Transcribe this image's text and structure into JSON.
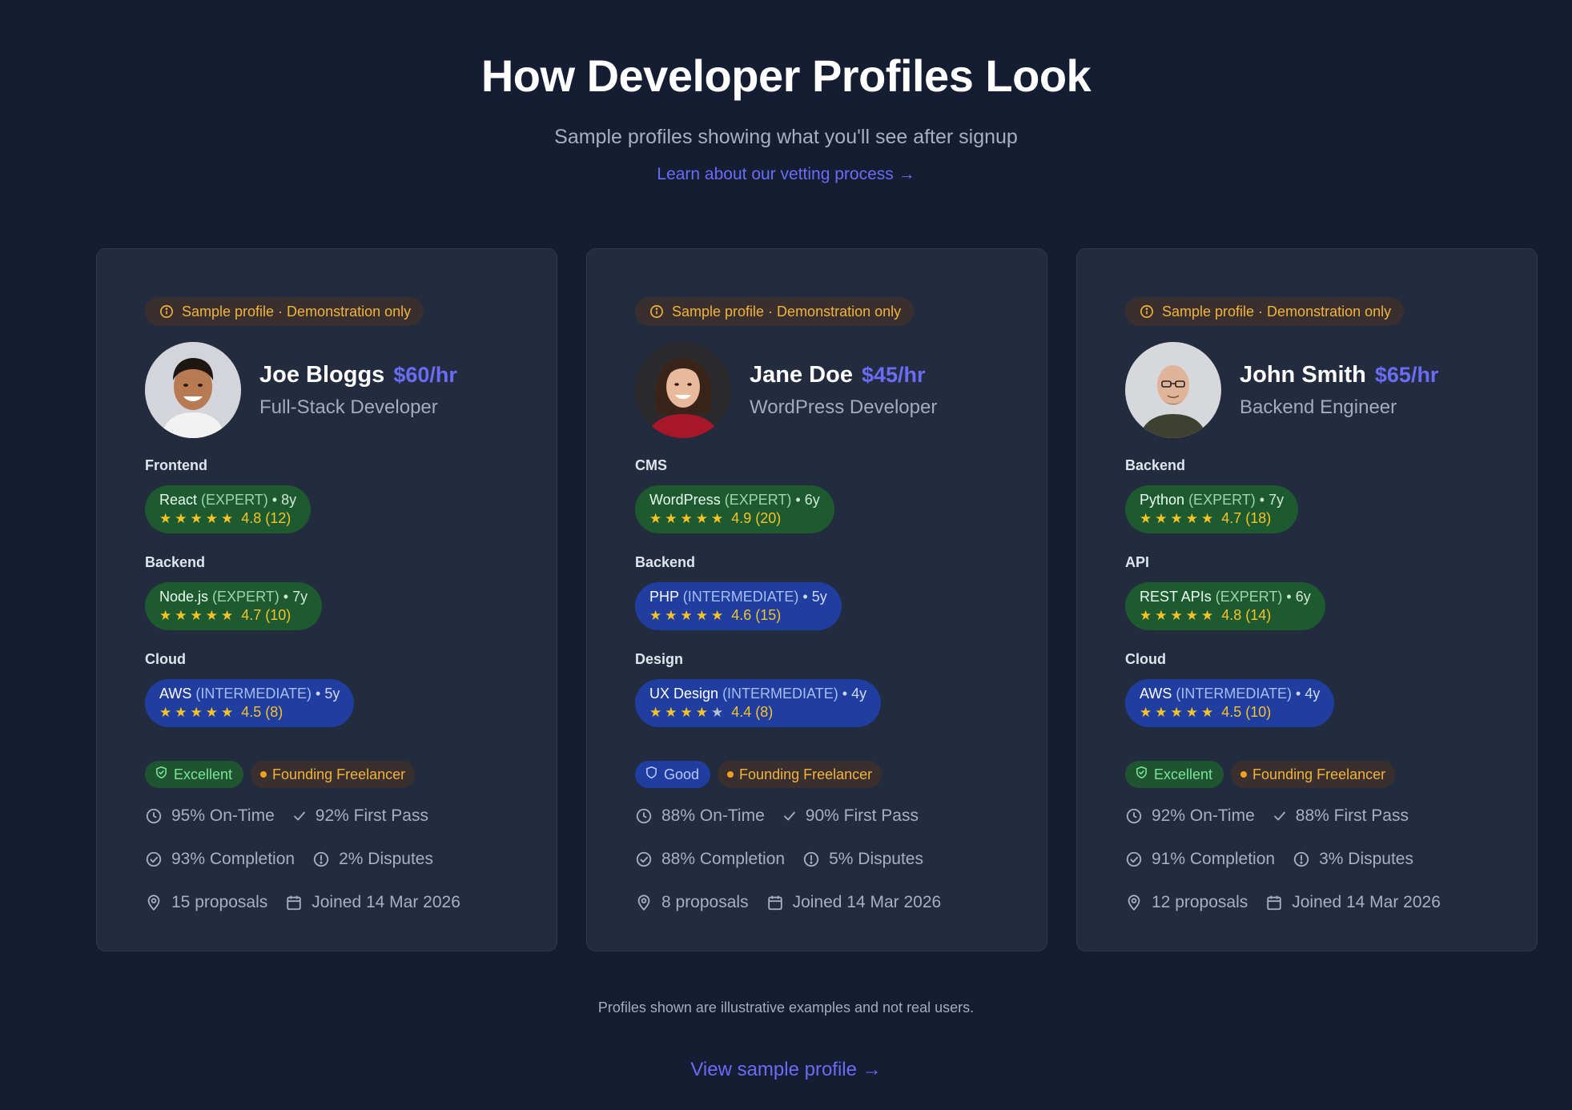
{
  "header": {
    "title": "How Developer Profiles Look",
    "subtitle": "Sample profiles showing what you'll see after signup",
    "vetting_link": "Learn about our vetting process →"
  },
  "profiles": [
    {
      "sample_badge": "Sample profile · Demonstration only",
      "name": "Joe Bloggs",
      "rate": "$60/hr",
      "role": "Full-Stack Developer",
      "skills": [
        {
          "category": "Frontend",
          "name": "React",
          "level": "(EXPERT)",
          "dot": "•",
          "years": "8y",
          "stars": 5,
          "rating": "4.8 (12)"
        },
        {
          "category": "Backend",
          "name": "Node.js",
          "level": "(EXPERT)",
          "dot": "•",
          "years": "7y",
          "stars": 5,
          "rating": "4.7 (10)"
        },
        {
          "category": "Cloud",
          "name": "AWS",
          "level": "(INTERMEDIATE)",
          "dot": "•",
          "years": "5y",
          "stars": 5,
          "rating": "4.5 (8)"
        }
      ],
      "tier": "Excellent",
      "founder": "Founding Freelancer",
      "on_time": "95% On-Time",
      "first_pass": "92% First Pass",
      "completion": "93% Completion",
      "disputes": "2% Disputes",
      "proposals": "15 proposals",
      "joined": "Joined 14 Mar 2026"
    },
    {
      "sample_badge": "Sample profile · Demonstration only",
      "name": "Jane Doe",
      "rate": "$45/hr",
      "role": "WordPress Developer",
      "skills": [
        {
          "category": "CMS",
          "name": "WordPress",
          "level": "(EXPERT)",
          "dot": "•",
          "years": "6y",
          "stars": 5,
          "rating": "4.9 (20)"
        },
        {
          "category": "Backend",
          "name": "PHP",
          "level": "(INTERMEDIATE)",
          "dot": "•",
          "years": "5y",
          "stars": 5,
          "rating": "4.6 (15)"
        },
        {
          "category": "Design",
          "name": "UX Design",
          "level": "(INTERMEDIATE)",
          "dot": "•",
          "years": "4y",
          "stars": 4,
          "rating": "4.4 (8)"
        }
      ],
      "tier": "Good",
      "founder": "Founding Freelancer",
      "on_time": "88% On-Time",
      "first_pass": "90% First Pass",
      "completion": "88% Completion",
      "disputes": "5% Disputes",
      "proposals": "8 proposals",
      "joined": "Joined 14 Mar 2026"
    },
    {
      "sample_badge": "Sample profile · Demonstration only",
      "name": "John Smith",
      "rate": "$65/hr",
      "role": "Backend Engineer",
      "skills": [
        {
          "category": "Backend",
          "name": "Python",
          "level": "(EXPERT)",
          "dot": "•",
          "years": "7y",
          "stars": 5,
          "rating": "4.7 (18)"
        },
        {
          "category": "API",
          "name": "REST APIs",
          "level": "(EXPERT)",
          "dot": "•",
          "years": "6y",
          "stars": 5,
          "rating": "4.8 (14)"
        },
        {
          "category": "Cloud",
          "name": "AWS",
          "level": "(INTERMEDIATE)",
          "dot": "•",
          "years": "4y",
          "stars": 5,
          "rating": "4.5 (10)"
        }
      ],
      "tier": "Excellent",
      "founder": "Founding Freelancer",
      "on_time": "92% On-Time",
      "first_pass": "88% First Pass",
      "completion": "91% Completion",
      "disputes": "3% Disputes",
      "proposals": "12 proposals",
      "joined": "Joined 14 Mar 2026"
    }
  ],
  "footer": {
    "note": "Profiles shown are illustrative examples and not real users.",
    "view_link": "View sample profile →"
  },
  "colors": {
    "background": "#141d32",
    "card": "#232b3e",
    "accent": "#6b6cf5",
    "expert_chip": "#1d5a30",
    "intermediate_chip": "#1f3ea0",
    "star": "#f6c325",
    "warning": "#f2b33a"
  },
  "icons": {
    "sample": "info-circle-icon",
    "tier": "shield-icon",
    "on_time": "clock-icon",
    "first_pass": "check-icon",
    "completion": "check-circle-icon",
    "disputes": "alert-circle-icon",
    "proposals": "map-pin-icon",
    "joined": "calendar-icon"
  }
}
